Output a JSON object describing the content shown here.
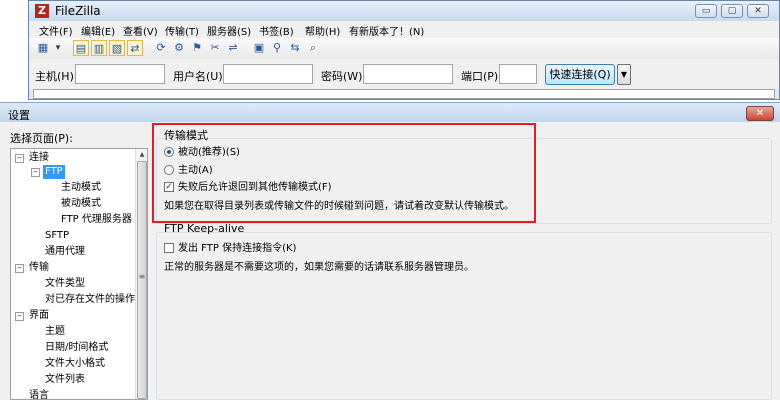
{
  "window": {
    "title": "FileZilla",
    "logo": "Z",
    "controls": {
      "minimize": "▭",
      "maximize": "▢",
      "close": "✕"
    }
  },
  "menu": [
    "文件(F)",
    "编辑(E)",
    "查看(V)",
    "传输(T)",
    "服务器(S)",
    "书签(B)",
    "帮助(H)",
    "有新版本了！(N)"
  ],
  "toolbar": {
    "icons": [
      "site-manager-icon",
      "dropdown-icon",
      "toggle-log-icon",
      "toggle-local-tree-icon",
      "toggle-remote-tree-icon",
      "toggle-queue-icon",
      "refresh-icon",
      "process-queue-icon",
      "cancel-icon",
      "disconnect-icon",
      "reconnect-icon",
      "directory-listing-icon",
      "filter-icon",
      "sync-browse-icon",
      "search-icon"
    ],
    "glyphs": [
      "▦",
      "▾",
      "▤",
      "▥",
      "▧",
      "⇄",
      "⟳",
      "⚙",
      "⚑",
      "✂",
      "⇌",
      "▣",
      "⚲",
      "⇆",
      "⌕"
    ]
  },
  "quickconnect": {
    "host_label": "主机(H):",
    "host_value": "",
    "user_label": "用户名(U):",
    "user_value": "",
    "pass_label": "密码(W):",
    "pass_value": "",
    "port_label": "端口(P):",
    "port_value": "",
    "button": "快速连接(Q)",
    "dropdown": "▼"
  },
  "dialog": {
    "title": "设置",
    "close": "✕",
    "page_label": "选择页面(P):",
    "tree": [
      {
        "label": "连接",
        "level": 0,
        "expander": "−"
      },
      {
        "label": "FTP",
        "level": 1,
        "expander": "−",
        "selected": true
      },
      {
        "label": "主动模式",
        "level": 2
      },
      {
        "label": "被动模式",
        "level": 2
      },
      {
        "label": "FTP 代理服务器",
        "level": 2
      },
      {
        "label": "SFTP",
        "level": 1
      },
      {
        "label": "通用代理",
        "level": 1
      },
      {
        "label": "传输",
        "level": 0,
        "expander": "−"
      },
      {
        "label": "文件类型",
        "level": 1
      },
      {
        "label": "对已存在文件的操作",
        "level": 1
      },
      {
        "label": "界面",
        "level": 0,
        "expander": "−"
      },
      {
        "label": "主题",
        "level": 1
      },
      {
        "label": "日期/时间格式",
        "level": 1
      },
      {
        "label": "文件大小格式",
        "level": 1
      },
      {
        "label": "文件列表",
        "level": 1
      },
      {
        "label": "语言",
        "level": 0
      }
    ],
    "scroll": {
      "up": "▲",
      "grip": "≡"
    },
    "transfer_mode": {
      "title": "传输模式",
      "passive": {
        "label": "被动(推荐)(S)",
        "checked": true
      },
      "active": {
        "label": "主动(A)",
        "checked": false
      },
      "fallback": {
        "label": "失败后允许退回到其他传输模式(F)",
        "checked": true,
        "mark": "✓"
      },
      "hint": "如果您在取得目录列表或传输文件的时候碰到问题，请试着改变默认传输模式。"
    },
    "keepalive": {
      "title": "FTP Keep-alive",
      "option": {
        "label": "发出 FTP 保持连接指令(K)",
        "checked": false
      },
      "hint": "正常的服务器是不需要这项的，如果您需要的话请联系服务器管理员。"
    }
  }
}
